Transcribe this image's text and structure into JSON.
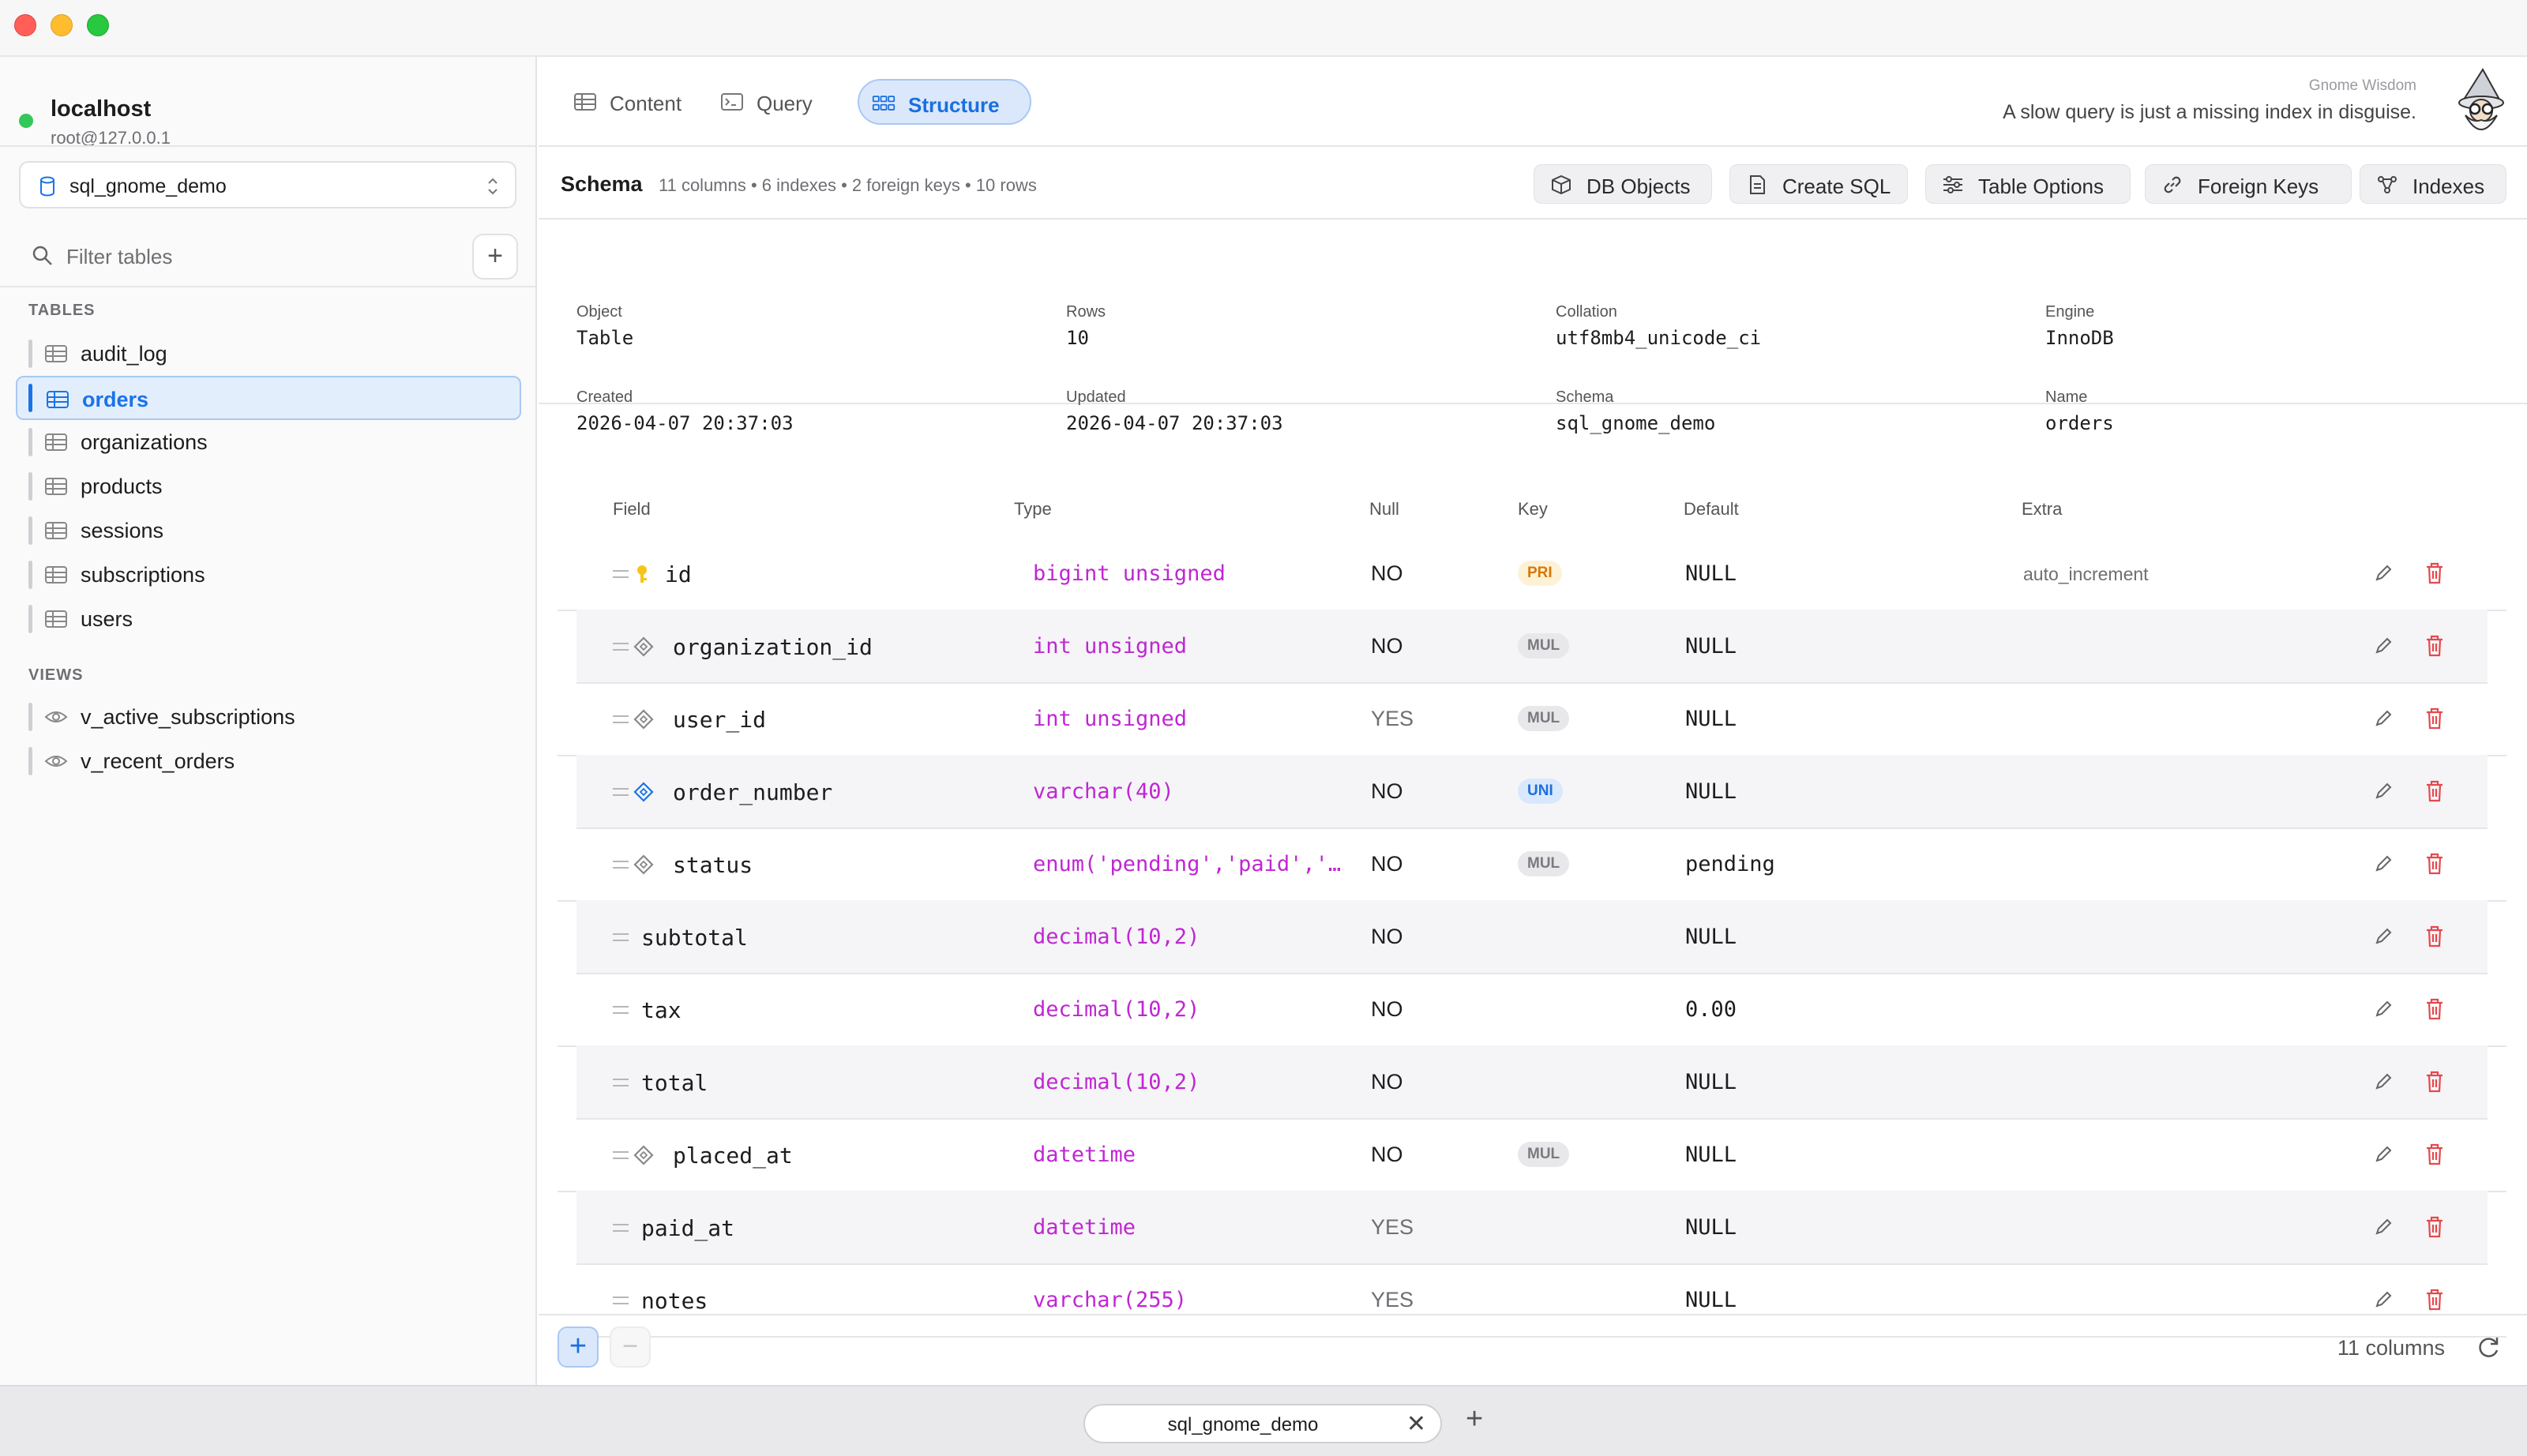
{
  "connection": {
    "name": "localhost",
    "user": "root@127.0.0.1",
    "status_color": "#34c759"
  },
  "database": {
    "selected": "sql_gnome_demo"
  },
  "filter": {
    "placeholder": "Filter tables",
    "add_label": "+"
  },
  "sidebar": {
    "tables_label": "TABLES",
    "tables": [
      "audit_log",
      "orders",
      "organizations",
      "products",
      "sessions",
      "subscriptions",
      "users"
    ],
    "active_table": "orders",
    "views_label": "VIEWS",
    "views": [
      "v_active_subscriptions",
      "v_recent_orders"
    ]
  },
  "tabs": [
    {
      "label": "Content",
      "icon": "table-icon",
      "active": false
    },
    {
      "label": "Query",
      "icon": "terminal-icon",
      "active": false
    },
    {
      "label": "Structure",
      "icon": "grid-icon",
      "active": true
    }
  ],
  "wisdom": {
    "title": "Gnome Wisdom",
    "quote": "A slow query is just a missing index in disguise."
  },
  "schema": {
    "title": "Schema",
    "meta": "11 columns • 6 indexes • 2 foreign keys • 10 rows",
    "buttons": [
      {
        "label": "DB Objects",
        "icon": "cube-icon"
      },
      {
        "label": "Create SQL",
        "icon": "document-icon"
      },
      {
        "label": "Table Options",
        "icon": "sliders-icon"
      },
      {
        "label": "Foreign Keys",
        "icon": "link-icon"
      },
      {
        "label": "Indexes",
        "icon": "branch-icon"
      }
    ]
  },
  "info": {
    "object_label": "Object",
    "object": "Table",
    "rows_label": "Rows",
    "rows": "10",
    "collation_label": "Collation",
    "collation": "utf8mb4_unicode_ci",
    "engine_label": "Engine",
    "engine": "InnoDB",
    "created_label": "Created",
    "created": "2026-04-07 20:37:03",
    "updated_label": "Updated",
    "updated": "2026-04-07 20:37:03",
    "schema_label": "Schema",
    "schema": "sql_gnome_demo",
    "name_label": "Name",
    "name": "orders"
  },
  "columns_table": {
    "headers": {
      "field": "Field",
      "type": "Type",
      "null": "Null",
      "key": "Key",
      "default": "Default",
      "extra": "Extra"
    },
    "rows": [
      {
        "field": "id",
        "type": "bigint unsigned",
        "null": "NO",
        "key": "PRI",
        "default": "NULL",
        "extra": "auto_increment",
        "icon": "key-icon"
      },
      {
        "field": "organization_id",
        "type": "int unsigned",
        "null": "NO",
        "key": "MUL",
        "default": "NULL",
        "extra": "",
        "icon": "index-diamond-icon"
      },
      {
        "field": "user_id",
        "type": "int unsigned",
        "null": "YES",
        "key": "MUL",
        "default": "NULL",
        "extra": "",
        "icon": "index-diamond-icon"
      },
      {
        "field": "order_number",
        "type": "varchar(40)",
        "null": "NO",
        "key": "UNI",
        "default": "NULL",
        "extra": "",
        "icon": "unique-diamond-icon"
      },
      {
        "field": "status",
        "type": "enum('pending','paid','…",
        "null": "NO",
        "key": "MUL",
        "default": "pending",
        "extra": "",
        "icon": "index-diamond-icon"
      },
      {
        "field": "subtotal",
        "type": "decimal(10,2)",
        "null": "NO",
        "key": "",
        "default": "NULL",
        "extra": "",
        "icon": ""
      },
      {
        "field": "tax",
        "type": "decimal(10,2)",
        "null": "NO",
        "key": "",
        "default": "0.00",
        "extra": "",
        "icon": ""
      },
      {
        "field": "total",
        "type": "decimal(10,2)",
        "null": "NO",
        "key": "",
        "default": "NULL",
        "extra": "",
        "icon": ""
      },
      {
        "field": "placed_at",
        "type": "datetime",
        "null": "NO",
        "key": "MUL",
        "default": "NULL",
        "extra": "",
        "icon": "index-diamond-icon"
      },
      {
        "field": "paid_at",
        "type": "datetime",
        "null": "YES",
        "key": "",
        "default": "NULL",
        "extra": "",
        "icon": ""
      },
      {
        "field": "notes",
        "type": "varchar(255)",
        "null": "YES",
        "key": "",
        "default": "NULL",
        "extra": "",
        "icon": ""
      }
    ]
  },
  "footer": {
    "add_label": "+",
    "remove_label": "−",
    "count": "11 columns"
  },
  "bottom_tabs": {
    "tab": "sql_gnome_demo",
    "close": "✕",
    "new": "+"
  },
  "colors": {
    "accent": "#1a73e8",
    "type_text": "#c026d3",
    "delete_red": "#e5484d",
    "pri_badge": "#d97706"
  }
}
